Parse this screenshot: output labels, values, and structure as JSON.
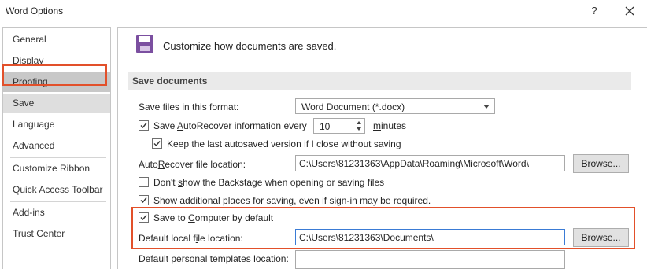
{
  "window": {
    "title": "Word Options",
    "help_label": "?"
  },
  "sidebar": {
    "items": [
      {
        "label": "General"
      },
      {
        "label": "Display"
      },
      {
        "label": "Proofing"
      },
      {
        "label": "Save"
      },
      {
        "label": "Language"
      },
      {
        "label": "Advanced"
      },
      {
        "label": "Customize Ribbon"
      },
      {
        "label": "Quick Access Toolbar"
      },
      {
        "label": "Add-ins"
      },
      {
        "label": "Trust Center"
      }
    ],
    "selected": "Save"
  },
  "header": {
    "text": "Customize how documents are saved.",
    "icon": "save-disk-icon"
  },
  "section": {
    "title": "Save documents"
  },
  "format": {
    "label": "Save files in this format:",
    "value": "Word Document (*.docx)"
  },
  "autorecover": {
    "label_pre": "Save ",
    "label_u": "A",
    "label_post": "utoRecover information every",
    "checked": true,
    "minutes_value": "10",
    "minutes_label_u": "m",
    "minutes_label_post": "inutes"
  },
  "keep_last": {
    "label": "Keep the last autosaved version if I close without saving",
    "checked": true
  },
  "autorecover_location": {
    "label_pre": "Auto",
    "label_u": "R",
    "label_post": "ecover file location:",
    "value": "C:\\Users\\81231363\\AppData\\Roaming\\Microsoft\\Word\\",
    "browse_label": "Browse..."
  },
  "backstage": {
    "label_pre": "Don't ",
    "label_u": "s",
    "label_post": "how the Backstage when opening or saving files",
    "checked": false
  },
  "additional_places": {
    "label_pre": "Show additional places for saving, even if ",
    "label_u": "s",
    "label_post": "ign-in may be required.",
    "checked": true
  },
  "save_to_computer": {
    "label_pre": "Save to ",
    "label_u": "C",
    "label_post": "omputer by default",
    "checked": true
  },
  "default_local": {
    "label_pre": "Default local f",
    "label_u": "i",
    "label_post": "le location:",
    "value": "C:\\Users\\81231363\\Documents\\",
    "browse_label": "Browse..."
  },
  "personal_templates": {
    "label_pre": "Default personal ",
    "label_u": "t",
    "label_post": "emplates location:",
    "value": ""
  },
  "colors": {
    "highlight": "#e2502a",
    "selected_nav": "#dedede",
    "hover_nav": "#c8c8c8",
    "save_icon": "#7b4fa0"
  }
}
